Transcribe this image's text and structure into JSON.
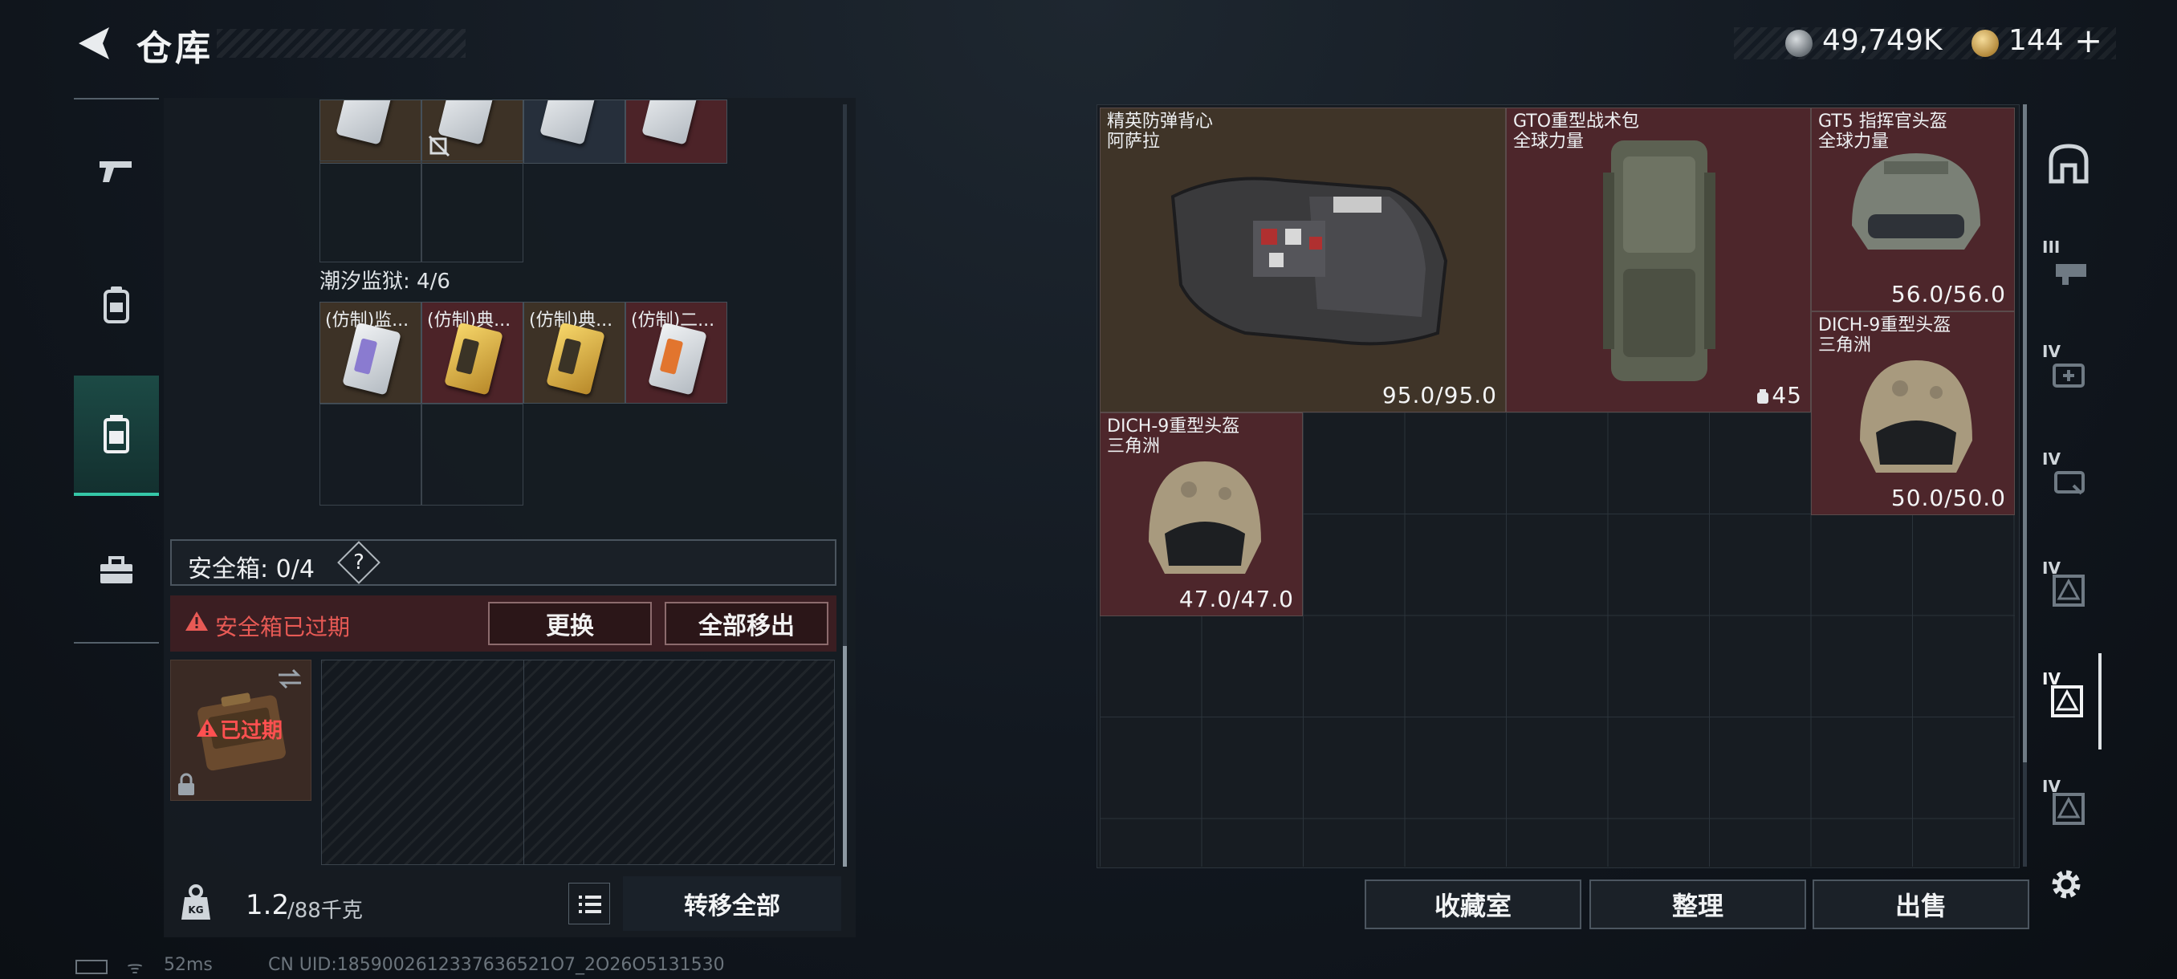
{
  "header": {
    "title": "仓库"
  },
  "currency": {
    "money": "49,749K",
    "coupon": "144",
    "coupon_add": "+"
  },
  "left_panel": {
    "partial_row_icon": "no-transfer-icon",
    "prison_label": "潮汐监狱: 4/6",
    "keys": [
      {
        "name": "(仿制)监...",
        "color": "white"
      },
      {
        "name": "(仿制)典...",
        "color": "gold"
      },
      {
        "name": "(仿制)典...",
        "color": "gold"
      },
      {
        "name": "(仿制)二...",
        "color": "white-orange"
      }
    ],
    "safe_box": {
      "label": "安全箱: 0/4",
      "help": "?",
      "expired_notice": "安全箱已过期",
      "replace_button": "更换",
      "move_all_button": "全部移出",
      "case_status": "已过期"
    },
    "weight": {
      "current": "1.2",
      "max": "/88千克"
    },
    "transfer_all_button": "转移全部"
  },
  "stash": {
    "items": [
      {
        "name": "精英防弹背心",
        "origin": "阿萨拉",
        "durability": "95.0/95.0",
        "icon": "armor-vest-icon",
        "bg": "brown"
      },
      {
        "name": "GTO重型战术包",
        "origin": "全球力量",
        "extra": "45",
        "extra_icon": "capacity-icon",
        "icon": "backpack-icon",
        "bg": "red"
      },
      {
        "name": "GT5 指挥官头盔",
        "origin": "全球力量",
        "durability": "56.0/56.0",
        "icon": "helmet-icon",
        "bg": "red"
      },
      {
        "name": "DICH-9重型头盔",
        "origin": "三角洲",
        "durability": "50.0/50.0",
        "icon": "helmet-icon",
        "bg": "red"
      },
      {
        "name": "DICH-9重型头盔",
        "origin": "三角洲",
        "durability": "47.0/47.0",
        "icon": "helmet-icon",
        "bg": "red"
      }
    ]
  },
  "actions": {
    "collection": "收藏室",
    "sort": "整理",
    "sell": "出售"
  },
  "right_rail": {
    "tiers": [
      "III",
      "IV",
      "IV",
      "IV",
      "IV",
      "IV"
    ]
  },
  "status": {
    "wifi": "ᯤ",
    "ping": "52ms",
    "uid": "CN UID:1859002612337636521O7_2O26O5131530"
  },
  "colors": {
    "accent": "#35c7a8",
    "danger": "#e85a55",
    "item_red": "#4d262b",
    "item_brown": "#3f3428"
  }
}
